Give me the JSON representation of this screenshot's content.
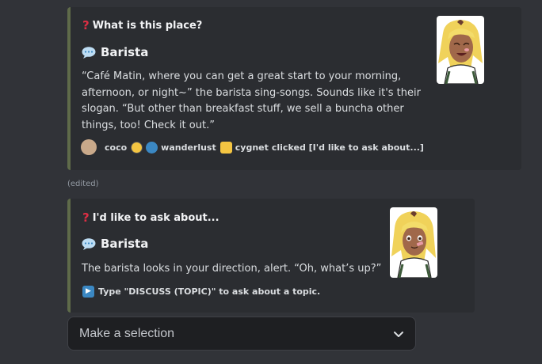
{
  "message1": {
    "title": "What is this place?",
    "author": "Barista",
    "description_lines": [
      "“Café Matin, where you can get a great start to your morning,",
      "afternoon, or night~” the barista sing-songs. Sounds like it's their",
      "slogan. “But other than breakfast stuff, we sell a buncha other",
      "things, too! Check it out.”"
    ],
    "footer": {
      "user1": "coco",
      "user2": "wanderlust",
      "user3": "cygnet",
      "action": "clicked [I'd like to ask about...]"
    },
    "edited_label": "(edited)"
  },
  "message2": {
    "title": "I'd like to ask about...",
    "author": "Barista",
    "description": "The barista looks in your direction, alert. “Oh, what’s up?”",
    "footer": "Type \"DISCUSS (TOPIC)\" to ask about a topic."
  },
  "select_menu": {
    "placeholder": "Make a selection"
  },
  "colors": {
    "embed_accent": "#5f6b4a",
    "background": "#313338",
    "embed_bg": "#2b2d31"
  },
  "icons": [
    "question-mark-icon",
    "speech-bubble-icon",
    "play-icon",
    "chevron-down-icon"
  ]
}
